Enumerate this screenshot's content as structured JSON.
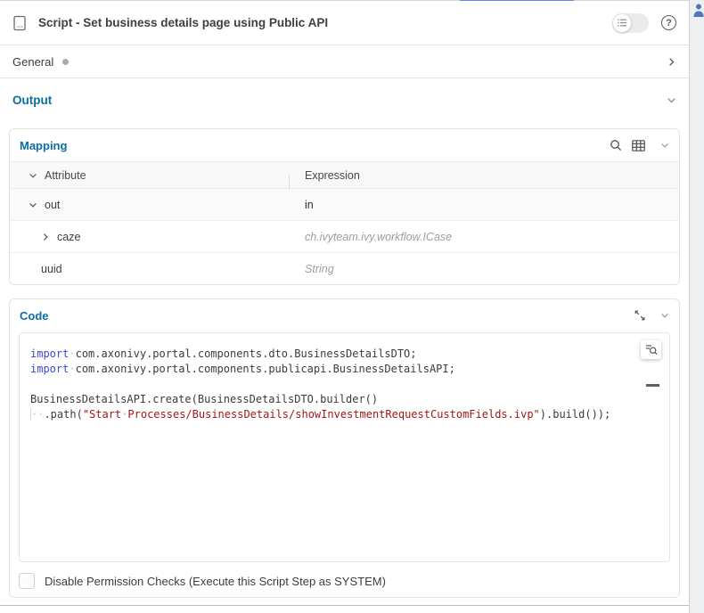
{
  "window": {
    "top_accent_color": "#6286e3"
  },
  "header": {
    "title": "Script - Set business details page using Public API",
    "help_glyph": "?"
  },
  "general_section": {
    "label": "General",
    "has_status_dot": true,
    "state": "collapsed"
  },
  "output_section": {
    "label": "Output",
    "state": "expanded",
    "mapping": {
      "label": "Mapping",
      "columns": [
        "Attribute",
        "Expression"
      ],
      "rows": [
        {
          "attribute": "out",
          "expression": "in",
          "indent": 0,
          "expander": "expanded",
          "expression_is_placeholder": false
        },
        {
          "attribute": "caze",
          "expression": "ch.ivyteam.ivy.workflow.ICase",
          "indent": 1,
          "expander": "collapsed",
          "expression_is_placeholder": true
        },
        {
          "attribute": "uuid",
          "expression": "String",
          "indent": 1,
          "expander": "none",
          "expression_is_placeholder": true
        }
      ]
    },
    "code": {
      "label": "Code",
      "lines": [
        [
          {
            "t": "import",
            "c": "kw"
          },
          {
            "t": "·",
            "c": "ws"
          },
          {
            "t": "com.axonivy.portal.components.dto.BusinessDetailsDTO;",
            "c": "pl"
          }
        ],
        [
          {
            "t": "import",
            "c": "kw"
          },
          {
            "t": "·",
            "c": "ws"
          },
          {
            "t": "com.axonivy.portal.components.publicapi.BusinessDetailsAPI;",
            "c": "pl"
          }
        ],
        [],
        [
          {
            "t": "BusinessDetailsAPI.create(BusinessDetailsDTO.builder()",
            "c": "pl"
          }
        ],
        [
          {
            "t": "",
            "c": "guide"
          },
          {
            "t": "··",
            "c": "ws"
          },
          {
            "t": ".path(",
            "c": "pl"
          },
          {
            "t": "\"Start",
            "c": "str"
          },
          {
            "t": "·",
            "c": "ws-str"
          },
          {
            "t": "Processes/BusinessDetails/showInvestmentRequestCustomFields.ivp\"",
            "c": "str"
          },
          {
            "t": ").build());",
            "c": "pl"
          }
        ]
      ]
    },
    "permission_checkbox": {
      "label": "Disable Permission Checks (Execute this Script Step as SYSTEM)",
      "checked": false
    }
  },
  "colors": {
    "accent_blue": "#0b6da4",
    "keyword_blue": "#3d49c9",
    "string_red": "#a31515",
    "code_text": "#3b3b3b",
    "placeholder_gray": "#9e9e9e"
  }
}
